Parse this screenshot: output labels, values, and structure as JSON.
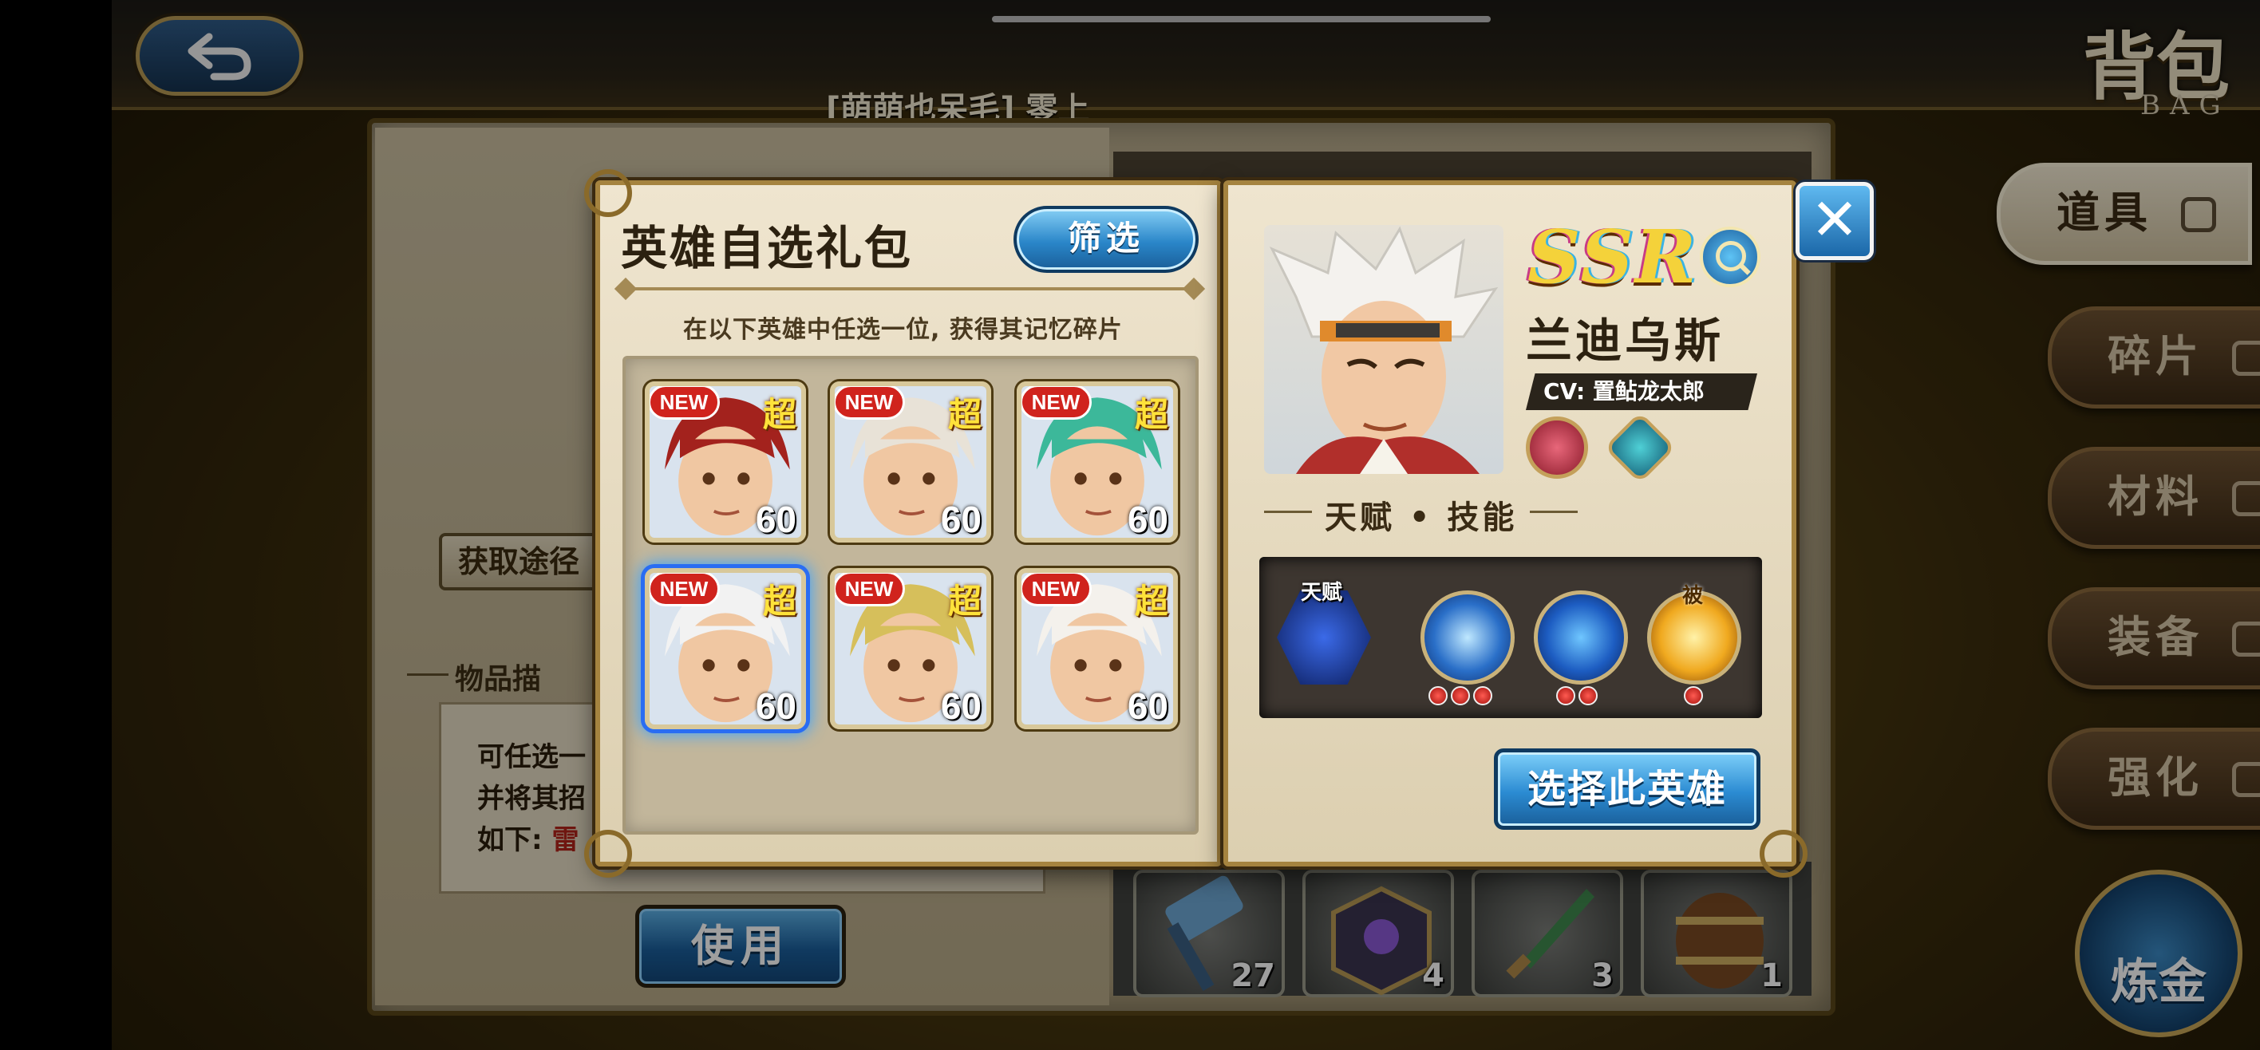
{
  "topbar": {
    "bag_title": "背包",
    "bag_subtitle": "BAG",
    "player_name": "[萌萌也呆毛] 零上"
  },
  "background": {
    "obtain_label": "获取途径",
    "desc_title": "物品描",
    "desc_lines": [
      "可任选一",
      "并将其招",
      "如下: "
    ],
    "desc_red": "雷",
    "use_label": "使用",
    "items": [
      {
        "icon": "hammer-icon",
        "count": "27"
      },
      {
        "icon": "cube-icon",
        "count": "4"
      },
      {
        "icon": "dagger-icon",
        "count": "3"
      },
      {
        "icon": "barrel-icon",
        "count": "1"
      }
    ]
  },
  "nav": {
    "items": [
      "道具",
      "碎片",
      "材料",
      "装备",
      "强化"
    ],
    "alchemy": "炼金"
  },
  "popup": {
    "title": "英雄自选礼包",
    "filter_label": "筛选",
    "subtitle": "在以下英雄中任选一位, 获得其记忆碎片",
    "heroes": [
      {
        "badge": "NEW",
        "rank": "超",
        "level": "60",
        "hair": "#a3221d",
        "selected": false
      },
      {
        "badge": "NEW",
        "rank": "超",
        "level": "60",
        "hair": "#e8e2d7",
        "selected": false
      },
      {
        "badge": "NEW",
        "rank": "超",
        "level": "60",
        "hair": "#3cb89a",
        "selected": false
      },
      {
        "badge": "NEW",
        "rank": "超",
        "level": "60",
        "hair": "#f2f2f2",
        "selected": true
      },
      {
        "badge": "NEW",
        "rank": "超",
        "level": "60",
        "hair": "#d6bf5b",
        "selected": false
      },
      {
        "badge": "NEW",
        "rank": "超",
        "level": "60",
        "hair": "#f4f1ec",
        "selected": false
      }
    ]
  },
  "detail": {
    "rarity": "SSR",
    "hero_name": "兰迪乌斯",
    "cv": "CV: 置鲇龙太郎",
    "skills_heading": "天赋 • 技能",
    "talent_tag": "天赋",
    "passive_tag": "被",
    "skill_dots": [
      3,
      2,
      1
    ],
    "select_label": "选择此英雄"
  },
  "colors": {
    "accent_blue": "#2a86c9",
    "new_red": "#d0231d",
    "rank_yellow": "#ffe23a",
    "panel_cream": "#efe5cf"
  }
}
